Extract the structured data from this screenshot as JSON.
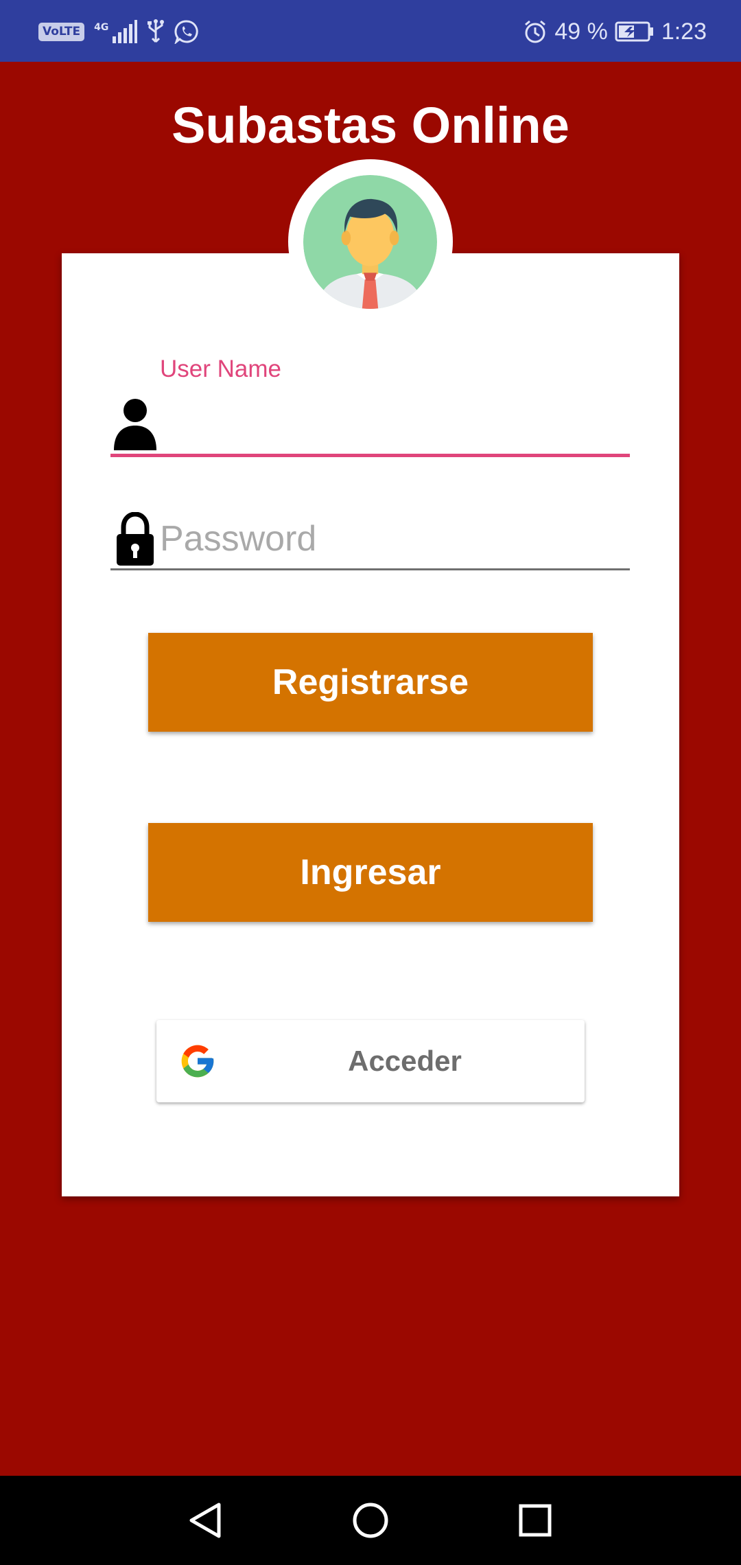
{
  "status_bar": {
    "volte": "VoLTE",
    "network": "4G",
    "battery_percent": "49 %",
    "time": "1:23",
    "icons": [
      "volte-icon",
      "signal-icon",
      "usb-icon",
      "whatsapp-icon",
      "alarm-icon",
      "battery-charging-icon"
    ]
  },
  "app": {
    "title": "Subastas Online"
  },
  "login_form": {
    "username_label": "User Name",
    "username_value": "",
    "username_icon": "person-icon",
    "password_placeholder": "Password",
    "password_value": "",
    "password_icon": "lock-icon",
    "register_label": "Registrarse",
    "login_label": "Ingresar",
    "google_label": "Acceder",
    "google_icon": "google-logo-icon"
  },
  "colors": {
    "background": "#9b0800",
    "status_bar": "#2f3e9e",
    "button": "#d47300",
    "accent": "#e0457b",
    "card": "#ffffff"
  },
  "nav_bar": {
    "buttons": [
      "back-icon",
      "home-icon",
      "recents-icon"
    ]
  }
}
